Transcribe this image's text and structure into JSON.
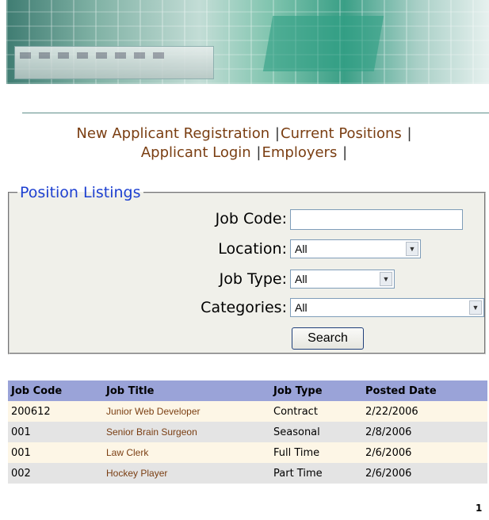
{
  "nav": {
    "links": [
      "New Applicant Registration",
      "Current Positions",
      "Applicant Login",
      "Employers"
    ],
    "separator": "|"
  },
  "search": {
    "legend": "Position Listings",
    "job_code_label": "Job Code:",
    "job_code_value": "",
    "location_label": "Location:",
    "location_value": "All",
    "job_type_label": "Job Type:",
    "job_type_value": "All",
    "categories_label": "Categories:",
    "categories_value": "All",
    "search_button": "Search"
  },
  "table": {
    "headers": [
      "Job Code",
      "Job Title",
      "Job Type",
      "Posted Date"
    ],
    "rows": [
      [
        "200612",
        "Junior Web Developer",
        "Contract",
        "2/22/2006"
      ],
      [
        "001",
        "Senior Brain Surgeon",
        "Seasonal",
        "2/8/2006"
      ],
      [
        "001",
        "Law Clerk",
        "Full Time",
        "2/6/2006"
      ],
      [
        "002",
        "Hockey Player",
        "Part Time",
        "2/6/2006"
      ]
    ]
  },
  "pager": {
    "page": "1"
  },
  "colors": {
    "link": "#7a3e12",
    "legend": "#1c3fd0",
    "header_bg": "#9aa3d8",
    "row_odd": "#fdf6e6",
    "row_even": "#e4e4e4"
  }
}
